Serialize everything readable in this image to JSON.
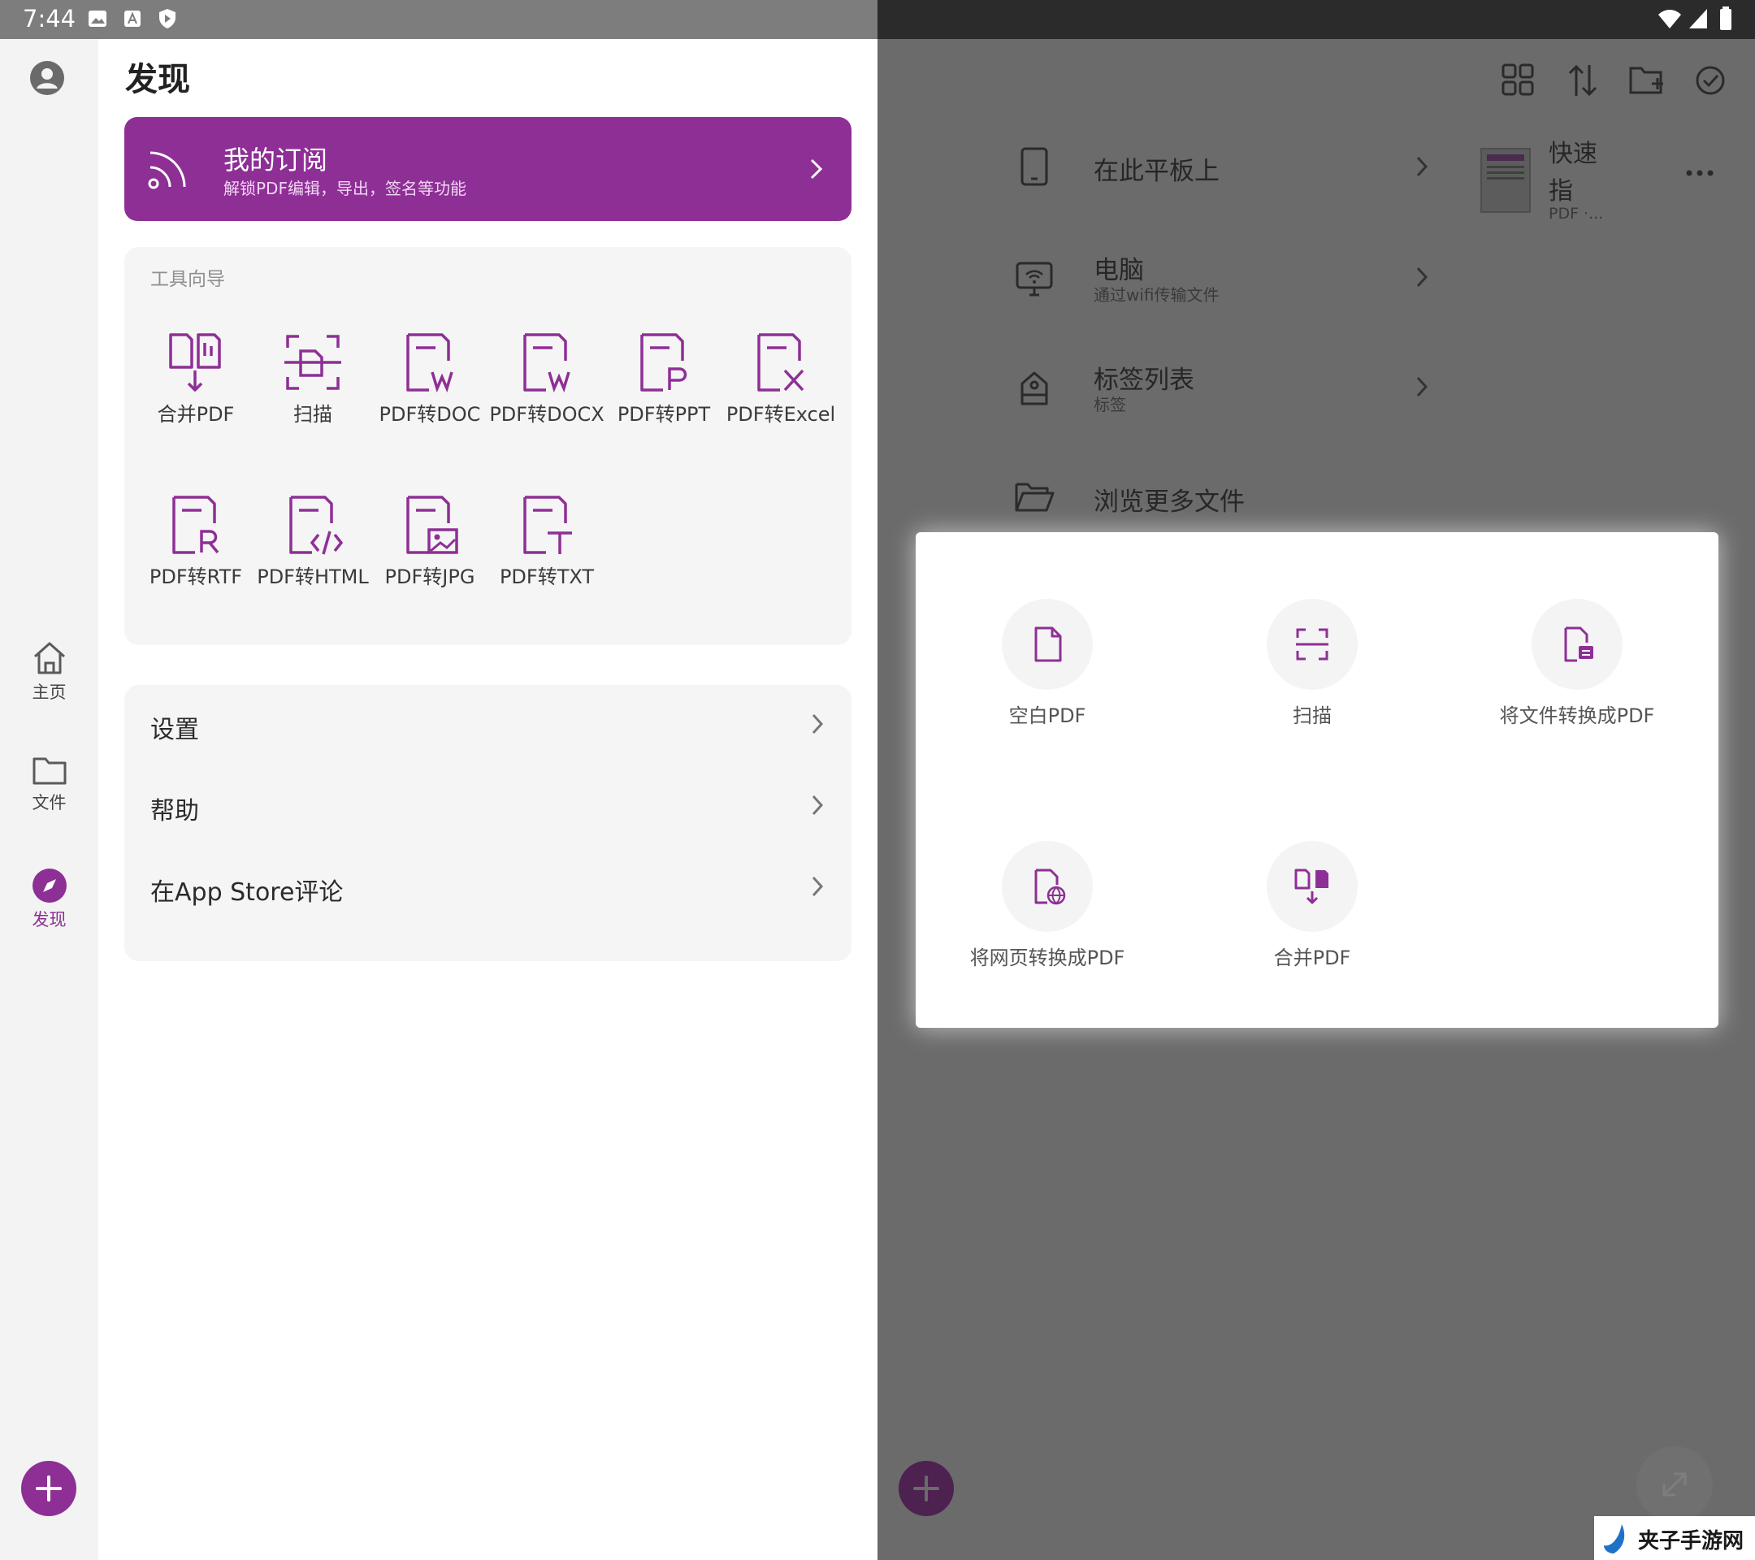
{
  "status_bar": {
    "time": "7:44"
  },
  "rail": {
    "home": "主页",
    "files": "文件",
    "discover": "发现"
  },
  "page": {
    "title": "发现"
  },
  "subscription": {
    "title": "我的订阅",
    "desc": "解锁PDF编辑，导出，签名等功能"
  },
  "tools": {
    "label": "工具向导",
    "items": [
      {
        "label": "合并PDF",
        "icon": "merge-pdf-icon"
      },
      {
        "label": "扫描",
        "icon": "scan-icon"
      },
      {
        "label": "PDF转DOC",
        "icon": "pdf-to-doc-icon"
      },
      {
        "label": "PDF转DOCX",
        "icon": "pdf-to-docx-icon"
      },
      {
        "label": "PDF转PPT",
        "icon": "pdf-to-ppt-icon"
      },
      {
        "label": "PDF转Excel",
        "icon": "pdf-to-excel-icon"
      },
      {
        "label": "PDF转RTF",
        "icon": "pdf-to-rtf-icon"
      },
      {
        "label": "PDF转HTML",
        "icon": "pdf-to-html-icon"
      },
      {
        "label": "PDF转JPG",
        "icon": "pdf-to-jpg-icon"
      },
      {
        "label": "PDF转TXT",
        "icon": "pdf-to-txt-icon"
      }
    ]
  },
  "menu": {
    "settings": "设置",
    "help": "帮助",
    "review": "在App Store评论"
  },
  "right": {
    "locations": [
      {
        "title": "在此平板上",
        "sub": ""
      },
      {
        "title": "电脑",
        "sub": "通过wifi传输文件"
      },
      {
        "title": "标签列表",
        "sub": "标签"
      },
      {
        "title": "浏览更多文件",
        "sub": ""
      }
    ],
    "recent": {
      "title_line1": "快速",
      "title_line2": "指",
      "meta": "PDF ·..."
    }
  },
  "dialog": {
    "options": [
      {
        "label": "空白PDF",
        "icon": "blank-pdf-icon"
      },
      {
        "label": "扫描",
        "icon": "scan-icon"
      },
      {
        "label": "将文件转换成PDF",
        "icon": "convert-file-icon"
      },
      {
        "label": "将网页转换成PDF",
        "icon": "convert-webpage-icon"
      },
      {
        "label": "合并PDF",
        "icon": "merge-pdf-icon"
      }
    ]
  },
  "watermark": {
    "text": "夹子手游网"
  },
  "colors": {
    "accent": "#8e2f96",
    "overlay": "#6b6b6b"
  }
}
